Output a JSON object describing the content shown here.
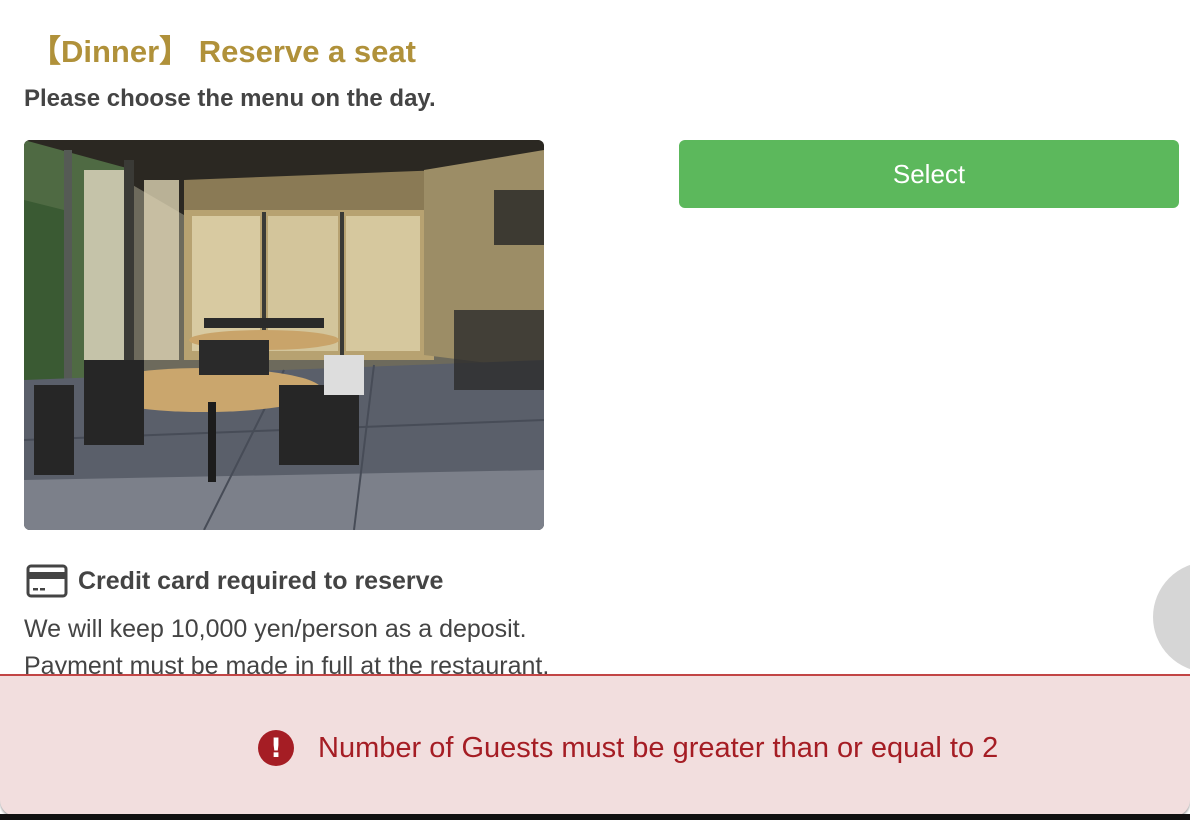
{
  "header": {
    "title": "【Dinner】 Reserve a seat",
    "subtitle": "Please choose the menu on the day."
  },
  "menu": {
    "select_label": "Select",
    "photo_description": "restaurant-interior-photo"
  },
  "notice": {
    "icon": "credit-card-icon",
    "title": "Credit card required to reserve",
    "deposit_text": "We will keep 10,000 yen/person as a deposit.",
    "payment_text": "Payment must be made in full at the restaurant."
  },
  "alert": {
    "icon": "exclamation-circle-icon",
    "message": "Number of Guests must be greater than or equal to 2",
    "icon_glyph": "!"
  },
  "colors": {
    "title": "#b0913a",
    "select_button": "#5cb85c",
    "alert_background": "#f2dede",
    "alert_text": "#a51d24"
  }
}
